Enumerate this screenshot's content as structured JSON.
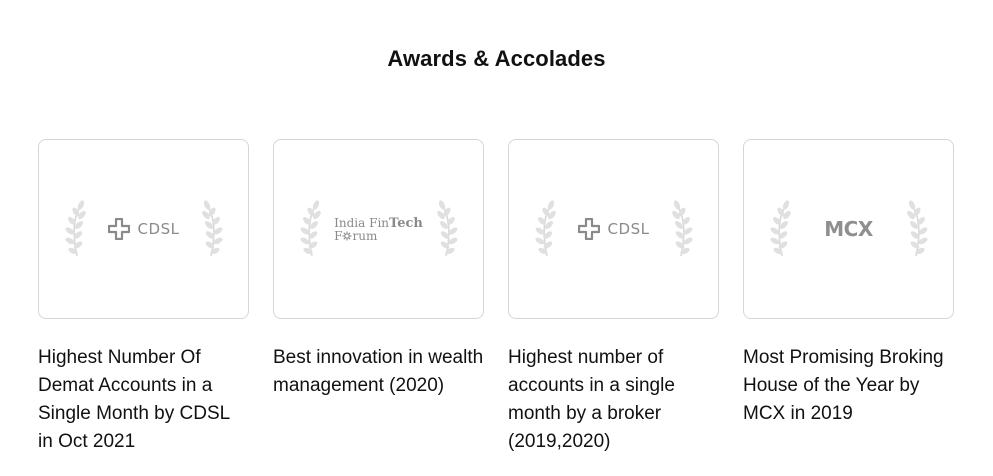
{
  "section": {
    "title": "Awards & Accolades"
  },
  "colors": {
    "text": "#111111",
    "border": "#d6d6d6",
    "logo_gray": "#8a8a8a",
    "laurel_gray": "#d9d9d9"
  },
  "awards": [
    {
      "logo": "CDSL",
      "logo_icon": "cdsl-cross-icon",
      "caption": "Highest Number Of Demat Accounts in a Single Month by CDSL in Oct 2021"
    },
    {
      "logo_line1_a": "India Fin",
      "logo_line1_b": "Tech",
      "logo_line2_a": "F",
      "logo_line2_b": "rum",
      "logo_icon": "gear-o-icon",
      "caption": "Best innovation in wealth management (2020)"
    },
    {
      "logo": "CDSL",
      "logo_icon": "cdsl-cross-icon",
      "caption": "Highest number of accounts in a single month by a broker (2019,2020)"
    },
    {
      "logo": "MCX",
      "caption": "Most Promising Broking House of the Year by MCX in 2019"
    }
  ]
}
